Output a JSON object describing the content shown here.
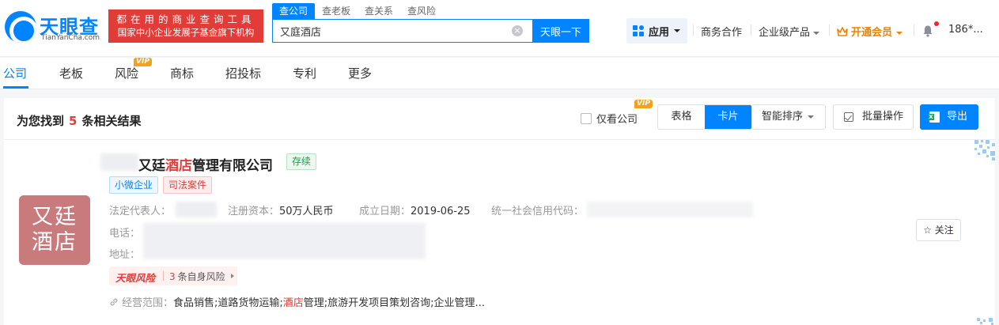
{
  "header": {
    "logo_cn": "天眼查",
    "logo_en": "TianYanCha.com",
    "slogan_line1": "都在用的商业查询工具",
    "slogan_line2": "国家中小企业发展子基金旗下机构",
    "search_tabs": [
      "查公司",
      "查老板",
      "查关系",
      "查风险"
    ],
    "search_value": "又庭酒店",
    "search_button": "天眼一下",
    "apps_label": "应用",
    "nav_business": "商务合作",
    "nav_enterprise": "企业级产品",
    "vip_label": "开通会员",
    "user_label": "186*..."
  },
  "category_tabs": [
    "公司",
    "老板",
    "风险",
    "商标",
    "招投标",
    "专利",
    "更多"
  ],
  "vip_badge": "VIP",
  "toolbar": {
    "count_prefix": "为您找到",
    "count": "5",
    "count_suffix": "条相关结果",
    "only_company": "仅看公司",
    "view_table": "表格",
    "view_card": "卡片",
    "sort": "智能排序",
    "bulk": "批量操作",
    "export": "导出"
  },
  "result": {
    "logo_text_line1": "又廷",
    "logo_text_line2": "酒店",
    "name_prefix": "又廷",
    "name_highlight": "酒店",
    "name_suffix": "管理有限公司",
    "status": "存续",
    "tags": [
      "小微企业",
      "司法案件"
    ],
    "legal_rep_label": "法定代表人：",
    "capital_label": "注册资本：",
    "capital_value": "50万人民币",
    "date_label": "成立日期：",
    "date_value": "2019-06-25",
    "credit_label": "统一社会信用代码：",
    "phone_label": "电话：",
    "address_label": "地址：",
    "risk_brand": "天眼风险",
    "risk_count": "3",
    "risk_text": "条自身风险",
    "scope_label": "经营范围：",
    "scope_part1": "食品销售;道路货物运输;",
    "scope_highlight": "酒店",
    "scope_part2": "管理;旅游开发项目策划咨询;企业管理...",
    "follow_label": "关注"
  },
  "colors": {
    "brand_blue": "#0084ff",
    "highlight_red": "#e23c39",
    "vip_orange": "#f08300",
    "status_green": "#1d9e48"
  }
}
